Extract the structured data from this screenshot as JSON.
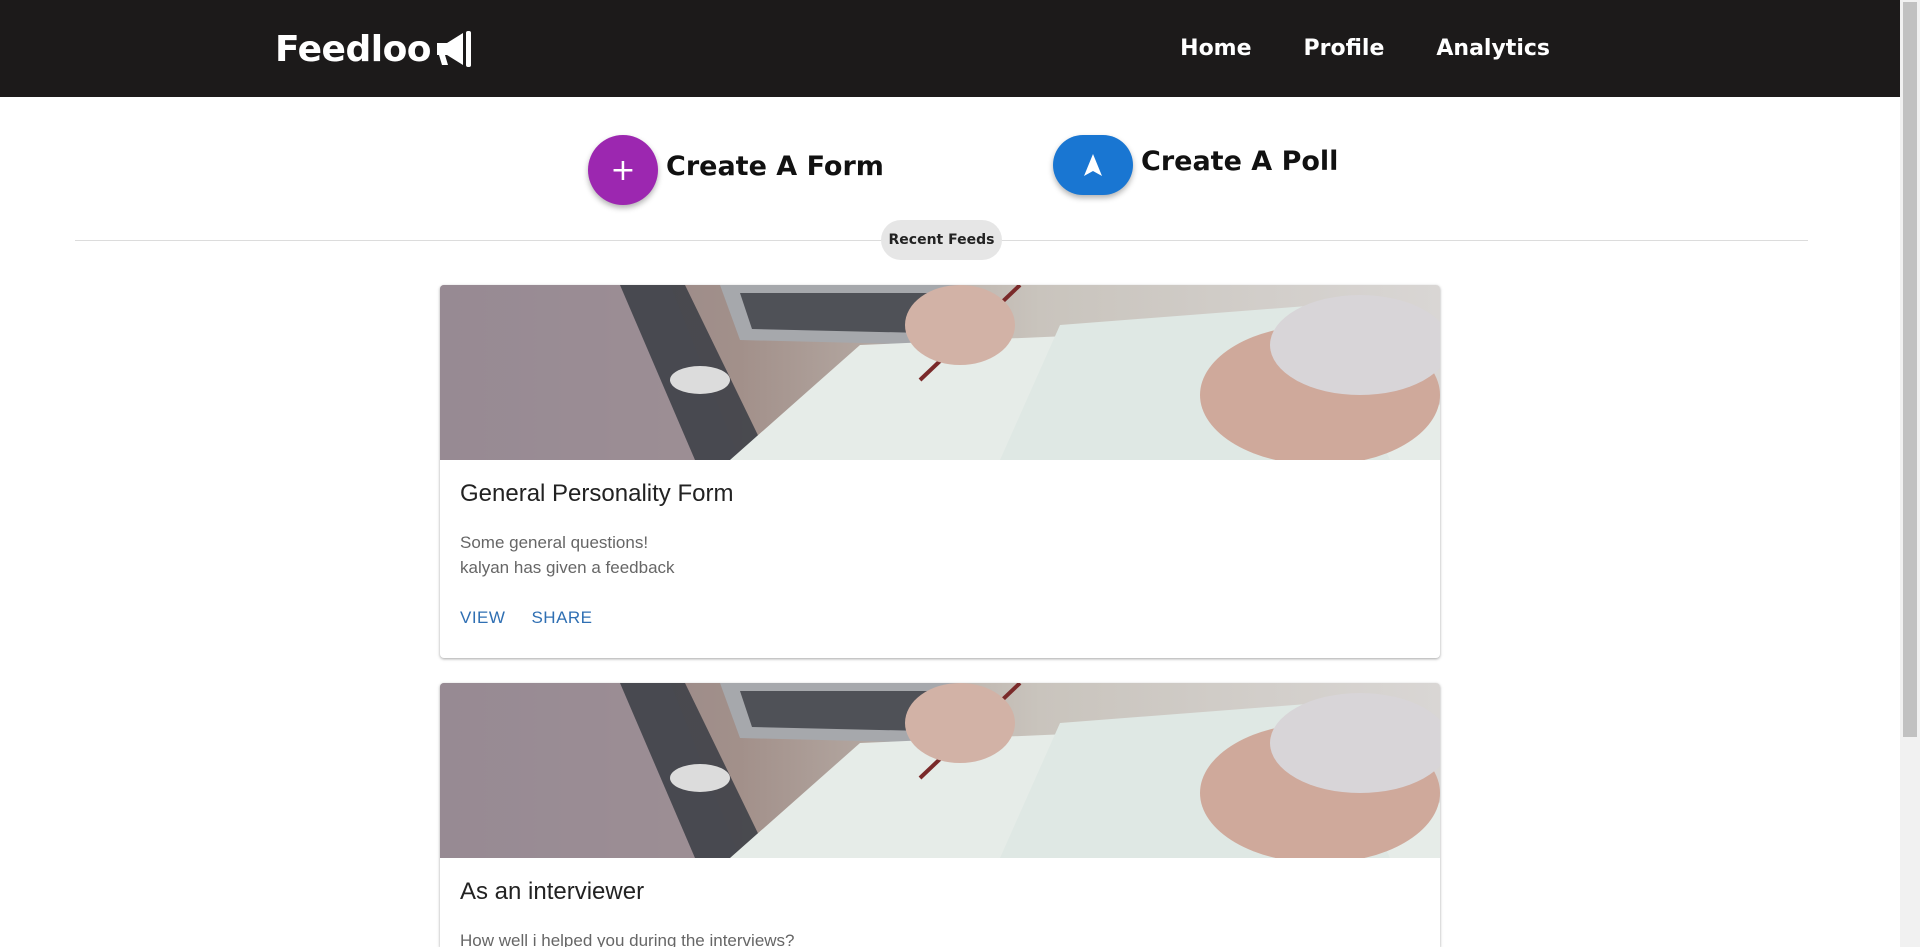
{
  "nav": {
    "brand": "Feedloo",
    "links": [
      "Home",
      "Profile",
      "Analytics"
    ]
  },
  "actions": {
    "create_form_label": "Create A Form",
    "create_form_icon": "+",
    "create_poll_label": "Create A Poll"
  },
  "section": {
    "chip_label": "Recent Feeds"
  },
  "cards": [
    {
      "title": "General Personality Form",
      "description": "Some general questions!",
      "feedback": "kalyan has given a feedback",
      "view_label": "VIEW",
      "share_label": "SHARE"
    },
    {
      "title": "As an interviewer",
      "description": "How well i helped you during the interviews?"
    }
  ],
  "colors": {
    "navbar": "#1c1a1a",
    "form_fab": "#9c27b0",
    "poll_fab": "#1976d2",
    "card_action": "#2f6fb3"
  }
}
